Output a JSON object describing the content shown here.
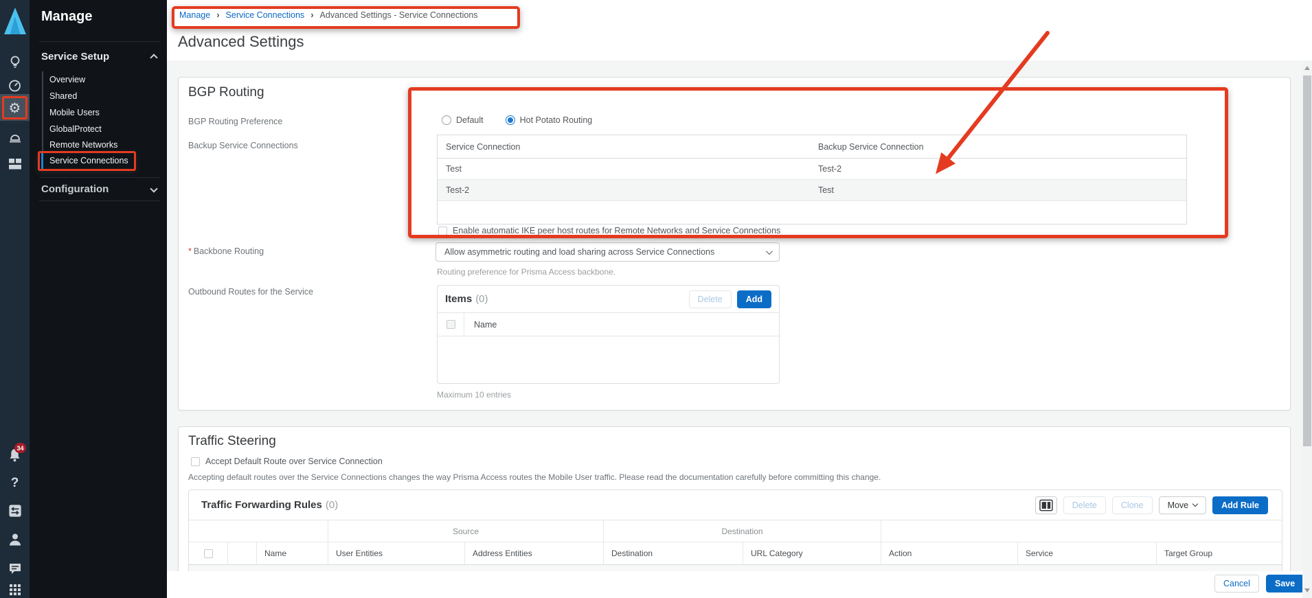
{
  "rail": {
    "badge": "34",
    "gear_glyph": "⚙",
    "help_glyph": "?"
  },
  "nav": {
    "title": "Manage",
    "service_setup": {
      "label": "Service Setup",
      "items": [
        "Overview",
        "Shared",
        "Mobile Users",
        "GlobalProtect",
        "Remote Networks",
        "Service Connections"
      ],
      "active_item": "Service Connections"
    },
    "configuration": {
      "label": "Configuration"
    }
  },
  "breadcrumb": {
    "separator": "›",
    "items": [
      "Manage",
      "Service Connections",
      "Advanced Settings - Service Connections"
    ]
  },
  "page_title": "Advanced Settings",
  "bgp": {
    "title": "BGP Routing",
    "preference_label": "BGP Routing Preference",
    "preference_options": [
      "Default",
      "Hot Potato Routing"
    ],
    "preference_selected": "Hot Potato Routing",
    "backup_label": "Backup Service Connections",
    "backup_table": {
      "headers": [
        "Service Connection",
        "Backup Service Connection"
      ],
      "rows": [
        {
          "service": "Test",
          "backup": "Test-2"
        },
        {
          "service": "Test-2",
          "backup": "Test"
        }
      ]
    },
    "ike_label": "Enable automatic IKE peer host routes for Remote Networks and Service Connections",
    "required_marker": "*",
    "backbone_label": "Backbone Routing",
    "backbone_value": "Allow asymmetric routing and load sharing across Service Connections",
    "backbone_help": "Routing preference for Prisma Access backbone.",
    "outbound_label": "Outbound Routes for the Service",
    "items_panel": {
      "title": "Items",
      "count": "(0)",
      "delete_label": "Delete",
      "add_label": "Add",
      "name_header": "Name",
      "max_note": "Maximum 10 entries"
    }
  },
  "traffic": {
    "title": "Traffic Steering",
    "accept_label": "Accept Default Route over Service Connection",
    "description": "Accepting default routes over the Service Connections changes the way Prisma Access routes the Mobile User traffic. Please read the documentation carefully before committing this change.",
    "rules": {
      "title": "Traffic Forwarding Rules",
      "count": "(0)",
      "delete_label": "Delete",
      "clone_label": "Clone",
      "move_label": "Move",
      "add_rule_label": "Add Rule",
      "groups": {
        "source": "Source",
        "destination": "Destination"
      },
      "columns": [
        "Name",
        "User Entities",
        "Address Entities",
        "Destination",
        "URL Category",
        "Action",
        "Service",
        "Target Group"
      ]
    }
  },
  "footer": {
    "cancel_label": "Cancel",
    "save_label": "Save"
  },
  "colors": {
    "annotation_red": "#e43b20",
    "primary_blue": "#0c6dc7",
    "link_blue": "#0b69c3",
    "rail_bg": "#1e2b39",
    "nav_bg": "#101419",
    "active_bar": "#1f7ed6"
  }
}
